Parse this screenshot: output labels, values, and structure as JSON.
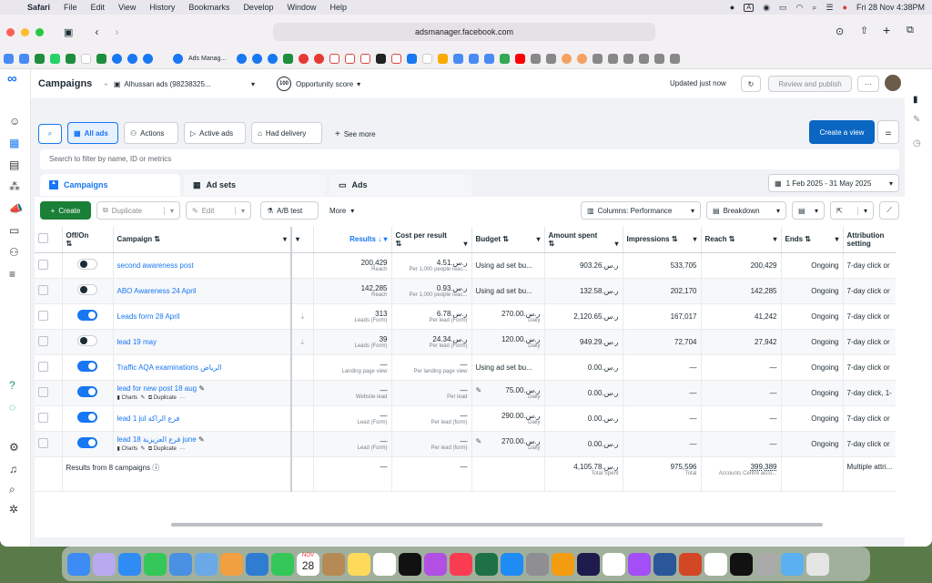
{
  "menubar": {
    "apple": "",
    "app": "Safari",
    "items": [
      "File",
      "Edit",
      "View",
      "History",
      "Bookmarks",
      "Develop",
      "Window",
      "Help"
    ],
    "input_badge": "A",
    "datetime": "Fri 28 Nov  4:38PM"
  },
  "browser": {
    "url": "adsmanager.facebook.com",
    "bookmark_label": "Ads Manag..."
  },
  "header": {
    "title": "Campaigns",
    "account": "Alhussan ads (98238325...",
    "score_badge": "100",
    "score_label": "Opportunity score",
    "updated": "Updated just now",
    "review": "Review and publish",
    "more": "···"
  },
  "filters": {
    "all_ads": "All ads",
    "actions": "Actions",
    "active_ads": "Active ads",
    "had_delivery": "Had delivery",
    "see_more": "See more",
    "create_view": "Create a view",
    "search_placeholder": "Search to filter by name, ID or metrics"
  },
  "tabs": {
    "campaigns": "Campaigns",
    "adsets": "Ad sets",
    "ads": "Ads",
    "daterange": "1 Feb 2025 - 31 May 2025"
  },
  "toolbar": {
    "create": "Create",
    "duplicate": "Duplicate",
    "edit": "Edit",
    "abtest": "A/B test",
    "more": "More",
    "columns": "Columns: Performance",
    "breakdown": "Breakdown"
  },
  "columns": {
    "offon": "Off/On",
    "campaign": "Campaign",
    "results": "Results",
    "cpr": "Cost per result",
    "budget": "Budget",
    "amount": "Amount spent",
    "impressions": "Impressions",
    "reach": "Reach",
    "ends": "Ends",
    "attribution": "Attribution setting"
  },
  "rows": [
    {
      "on": false,
      "name": "second awareness post",
      "results": "200,429",
      "results_sub": "Reach",
      "cpr": "4.51.ر.س",
      "cpr_sub": "Per 1,000 people reac...",
      "budget": "Using ad set bu...",
      "budget_sub": "",
      "amount": "903.26.ر.س",
      "impressions": "533,705",
      "reach": "200,429",
      "ends": "Ongoing",
      "attr": "7-day click or",
      "tools": false
    },
    {
      "on": false,
      "name": "ABO Awareness 24 April",
      "results": "142,285",
      "results_sub": "Reach",
      "cpr": "0.93.ر.س",
      "cpr_sub": "Per 1,000 people reac...",
      "budget": "Using ad set bu...",
      "budget_sub": "",
      "amount": "132.58.ر.س",
      "impressions": "202,170",
      "reach": "142,285",
      "ends": "Ongoing",
      "attr": "7-day click or",
      "tools": false
    },
    {
      "on": true,
      "name": "Leads form 28 April",
      "results": "313",
      "results_sub": "Leads (Form)",
      "cpr": "6.78.ر.س",
      "cpr_sub": "Per lead (Form)",
      "budget": "270.00.ر.س",
      "budget_sub": "Daily",
      "amount": "2,120.65.ر.س",
      "impressions": "167,017",
      "reach": "41,242",
      "ends": "Ongoing",
      "attr": "7-day click or",
      "tools": false
    },
    {
      "on": false,
      "name": "lead 19 may",
      "results": "39",
      "results_sub": "Leads (Form)",
      "cpr": "24.34.ر.س",
      "cpr_sub": "Per lead (Form)",
      "budget": "120.00.ر.س",
      "budget_sub": "Daily",
      "amount": "949.29.ر.س",
      "impressions": "72,704",
      "reach": "27,942",
      "ends": "Ongoing",
      "attr": "7-day click or",
      "tools": false
    },
    {
      "on": true,
      "name": "Traffic AQA examinations الرياض",
      "results": "—",
      "results_sub": "Landing page view",
      "cpr": "—",
      "cpr_sub": "Per landing page view",
      "budget": "Using ad set bu...",
      "budget_sub": "",
      "amount": "0.00.ر.س",
      "impressions": "—",
      "reach": "—",
      "ends": "Ongoing",
      "attr": "7-day click or",
      "tools": false
    },
    {
      "on": true,
      "name": "lead for new post 18 aug",
      "results": "—",
      "results_sub": "Website lead",
      "cpr": "—",
      "cpr_sub": "Per lead",
      "budget": "75.00.ر.س",
      "budget_sub": "Daily",
      "amount": "0.00.ر.س",
      "impressions": "—",
      "reach": "—",
      "ends": "Ongoing",
      "attr": "7-day click, 1-",
      "tools": true
    },
    {
      "on": true,
      "name": "lead 1 jul فرع الراكة",
      "results": "—",
      "results_sub": "Lead (Form)",
      "cpr": "—",
      "cpr_sub": "Per lead (form)",
      "budget": "290.00.ر.س",
      "budget_sub": "Daily",
      "amount": "0.00.ر.س",
      "impressions": "—",
      "reach": "—",
      "ends": "Ongoing",
      "attr": "7-day click or",
      "tools": false
    },
    {
      "on": true,
      "name": "lead 18 فرع العزيزية june",
      "results": "—",
      "results_sub": "Lead (Form)",
      "cpr": "—",
      "cpr_sub": "Per lead (form)",
      "budget": "270.00.ر.س",
      "budget_sub": "Daily",
      "amount": "0.00.ر.س",
      "impressions": "—",
      "reach": "—",
      "ends": "Ongoing",
      "attr": "7-day click or",
      "tools": true
    }
  ],
  "row_tools": {
    "charts": "Charts",
    "duplicate": "Duplicate",
    "more": "···"
  },
  "totals": {
    "label": "Results from 8 campaigns",
    "results": "—",
    "cpr": "—",
    "amount": "4,105.78.ر.س",
    "amount_sub": "Total Spent",
    "impressions": "975,596",
    "impressions_sub": "Total",
    "reach": "399,389",
    "reach_sub": "Accounts Centre acco...",
    "attr": "Multiple attri..."
  },
  "dock_calendar": {
    "month": "NOV",
    "day": "28"
  }
}
